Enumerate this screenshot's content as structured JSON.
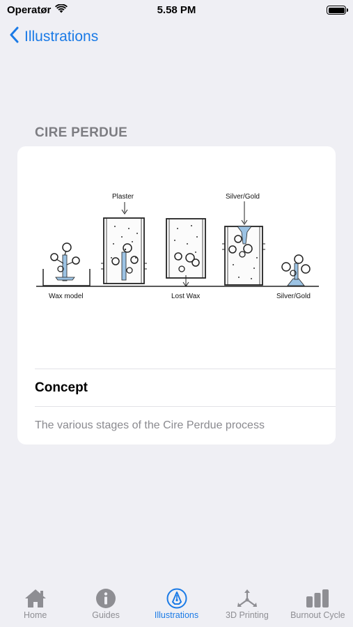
{
  "status_bar": {
    "carrier": "Operatør",
    "time": "5.58 PM",
    "wifi_icon": "wifi-icon",
    "battery_icon": "battery-icon"
  },
  "nav": {
    "back_label": "Illustrations",
    "back_icon": "chevron-left-icon"
  },
  "section": {
    "title": "CIRE PERDUE"
  },
  "card": {
    "illustration": {
      "labels": {
        "plaster": "Plaster",
        "silver_gold_top": "Silver/Gold",
        "wax_model": "Wax model",
        "lost_wax": "Lost Wax",
        "silver_gold_bottom": "Silver/Gold"
      }
    },
    "concept_title": "Concept",
    "concept_text": "The various stages of the Cire Perdue process"
  },
  "tabs": [
    {
      "label": "Home",
      "icon": "house-icon",
      "active": false
    },
    {
      "label": "Guides",
      "icon": "info-circle-icon",
      "active": false
    },
    {
      "label": "Illustrations",
      "icon": "pen-nib-icon",
      "active": true
    },
    {
      "label": "3D Printing",
      "icon": "axes-3d-icon",
      "active": false
    },
    {
      "label": "Burnout Cycle",
      "icon": "bar-chart-icon",
      "active": false
    }
  ],
  "colors": {
    "accent": "#1a7ae6",
    "inactive": "#8e8e93",
    "background": "#efeff4",
    "wax_blue": "#9cc3e4"
  }
}
